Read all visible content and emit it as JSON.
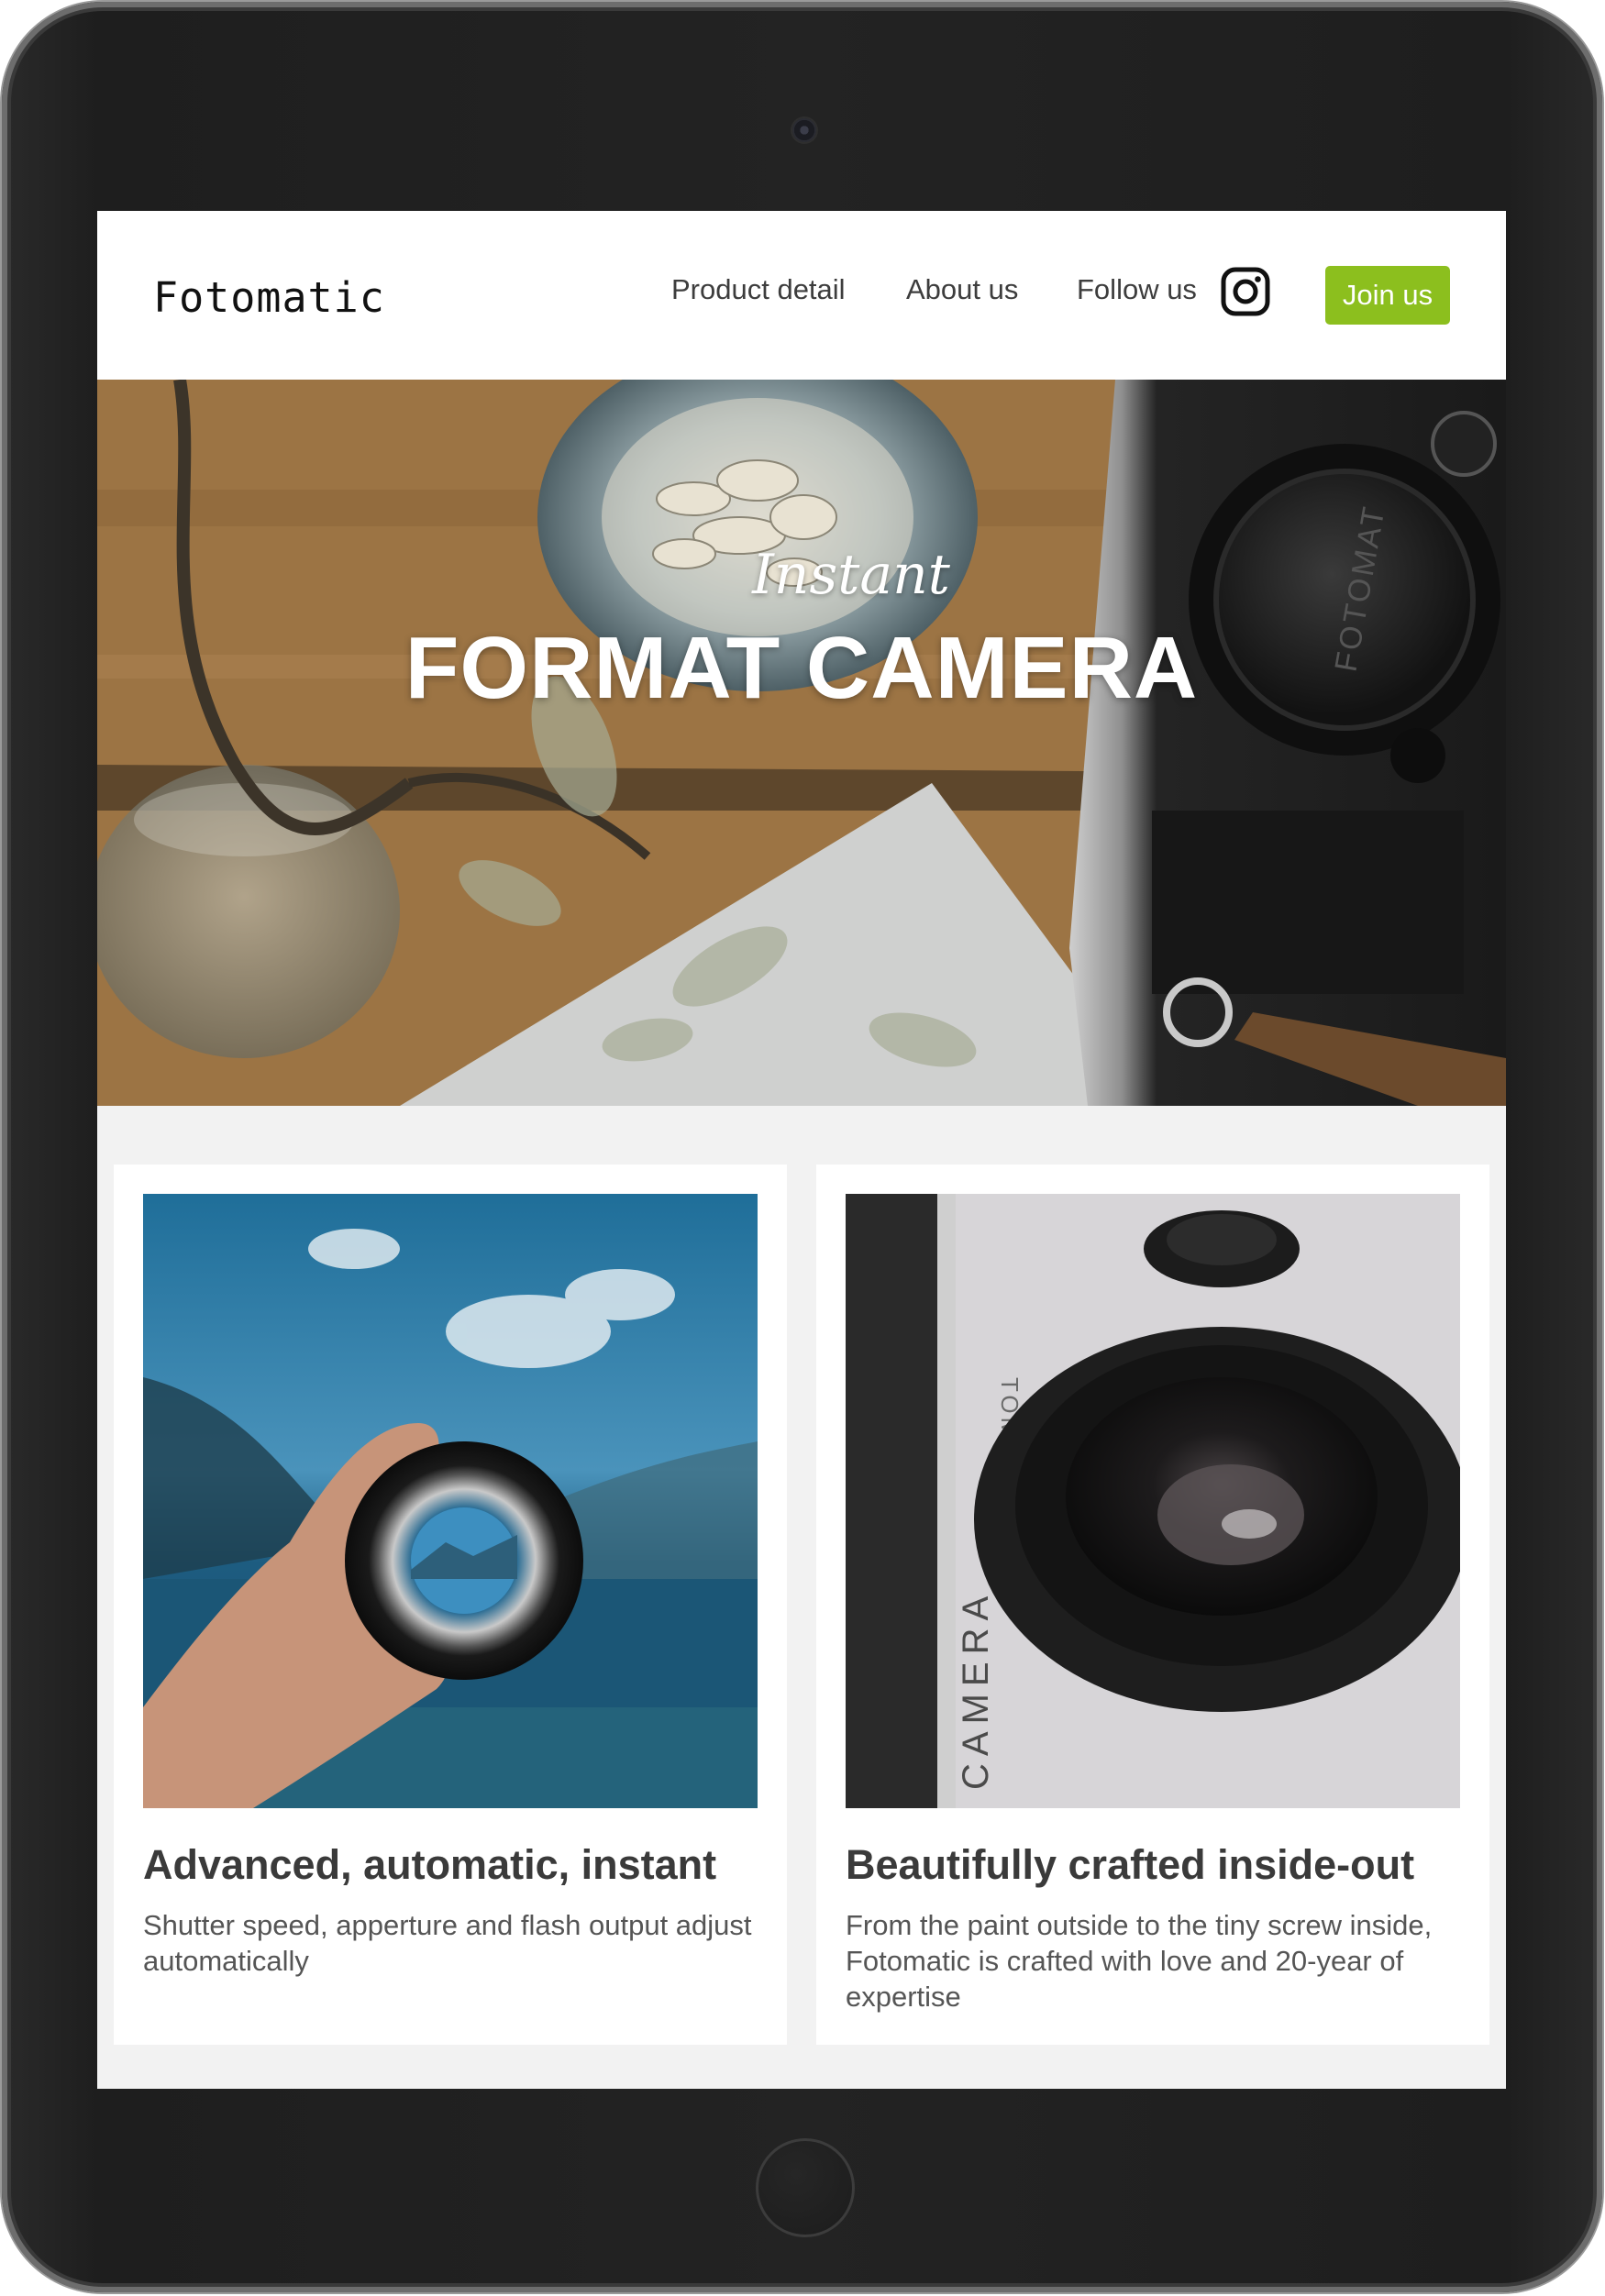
{
  "colors": {
    "accent": "#8cbf1e",
    "screen_bg": "#f2f2f2",
    "frame": "#1f1f1f"
  },
  "nav": {
    "logo": "Fotomatic",
    "links": [
      "Product detail",
      "About us",
      "Follow us"
    ],
    "instagram_icon": "instagram-icon",
    "join_label": "Join us"
  },
  "hero": {
    "script_text": "Instant",
    "title": "FORMAT CAMERA",
    "camera_cap_text": "FOTOMAT"
  },
  "cards": [
    {
      "title": "Advanced, automatic, instant",
      "text": "Shutter speed, apperture and flash output adjust automatically"
    },
    {
      "title": "Beautifully crafted inside-out",
      "text": "From the paint outside to the tiny screw inside, Fotomatic is crafted with love and 20-year of expertise",
      "photo_labels": [
        "CAMERA",
        "TOMATIC"
      ]
    }
  ]
}
